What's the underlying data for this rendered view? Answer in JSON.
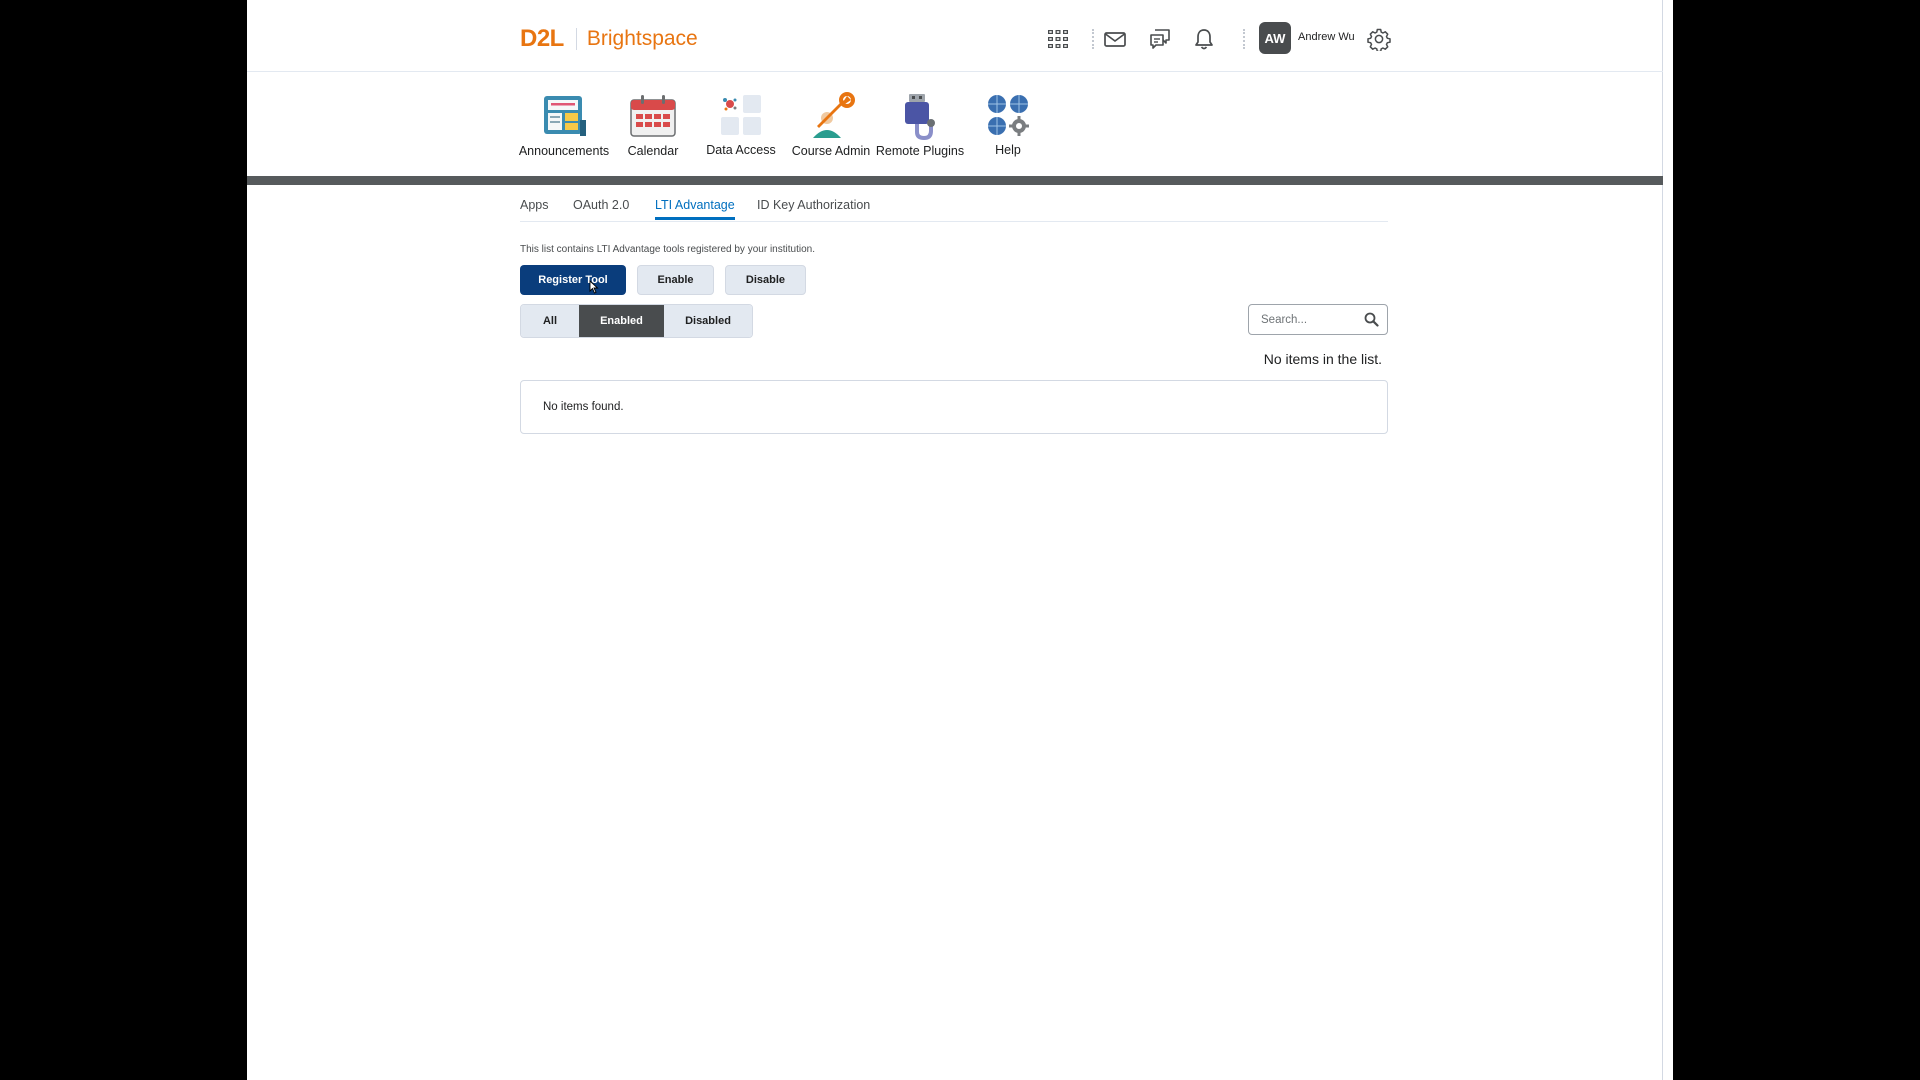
{
  "brand": {
    "logo": "D2L",
    "product": "Brightspace",
    "color": "#e87511"
  },
  "header": {
    "icons": [
      "waffle-icon",
      "mail-icon",
      "chat-icon",
      "bell-icon",
      "gear-icon"
    ],
    "user": {
      "initials": "AW",
      "name": "Andrew Wu"
    }
  },
  "navbar": {
    "items": [
      {
        "label": "Announcements",
        "icon": "announcements-icon"
      },
      {
        "label": "Calendar",
        "icon": "calendar-icon"
      },
      {
        "label": "Data Access",
        "icon": "data-access-icon"
      },
      {
        "label": "Course Admin",
        "icon": "course-admin-icon"
      },
      {
        "label": "Remote Plugins",
        "icon": "remote-plugins-icon"
      },
      {
        "label": "Help",
        "icon": "help-icon"
      }
    ]
  },
  "tabs": [
    {
      "label": "Apps",
      "active": false
    },
    {
      "label": "OAuth 2.0",
      "active": false
    },
    {
      "label": "LTI Advantage",
      "active": true
    },
    {
      "label": "ID Key Authorization",
      "active": false
    }
  ],
  "description": "This list contains LTI Advantage tools registered by your institution.",
  "actions": {
    "register": "Register Tool",
    "enable": "Enable",
    "disable": "Disable"
  },
  "filters": {
    "all": "All",
    "enabled": "Enabled",
    "disabled": "Disabled",
    "selected": "Enabled"
  },
  "search": {
    "placeholder": "Search...",
    "value": ""
  },
  "list": {
    "status": "No items in the list.",
    "empty_message": "No items found."
  },
  "colors": {
    "primary": "#0a3d7c",
    "active_tab": "#006fbf",
    "nav_bar": "#565a5c"
  }
}
